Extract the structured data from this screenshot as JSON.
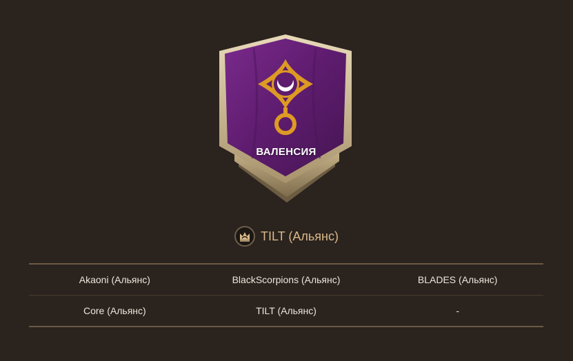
{
  "emblem": {
    "name": "ВАЛЕНСИЯ",
    "banner_color": "#5e1c6e",
    "symbol_color": "#dd9a24",
    "icon": "crescent-moon-emblem-icon"
  },
  "owner": {
    "name": "TILT (Альянс)",
    "icon": "crown-badge-icon",
    "color": "#d9b98a"
  },
  "alliances": {
    "rows": [
      [
        "Akaoni (Альянс)",
        "BlackScorpions (Альянс)",
        "BLADES (Альянс)"
      ],
      [
        "Core (Альянс)",
        "TILT (Альянс)",
        "-"
      ]
    ]
  }
}
